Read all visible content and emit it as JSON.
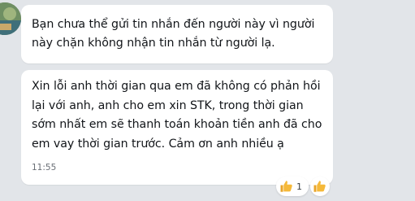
{
  "messages": [
    {
      "text": "Bạn chưa thể gửi tin nhắn đến người này vì người này chặn không nhận tin nhắn từ người lạ."
    },
    {
      "text": "Xin lỗi anh thời gian qua em đã không có phản hồi lại với anh, anh cho em xin STK, trong thời gian sớm nhất em sẽ thanh toán khoản tiền anh đã cho em vay thời gian trước. Cảm ơn anh nhiều ạ",
      "time": "11:55",
      "reaction": {
        "icon": "thumbs-up-icon",
        "count": "1"
      }
    }
  ],
  "colors": {
    "background": "#e2e5e9",
    "bubble": "#ffffff",
    "reaction_yellow": "#f5b93a"
  }
}
